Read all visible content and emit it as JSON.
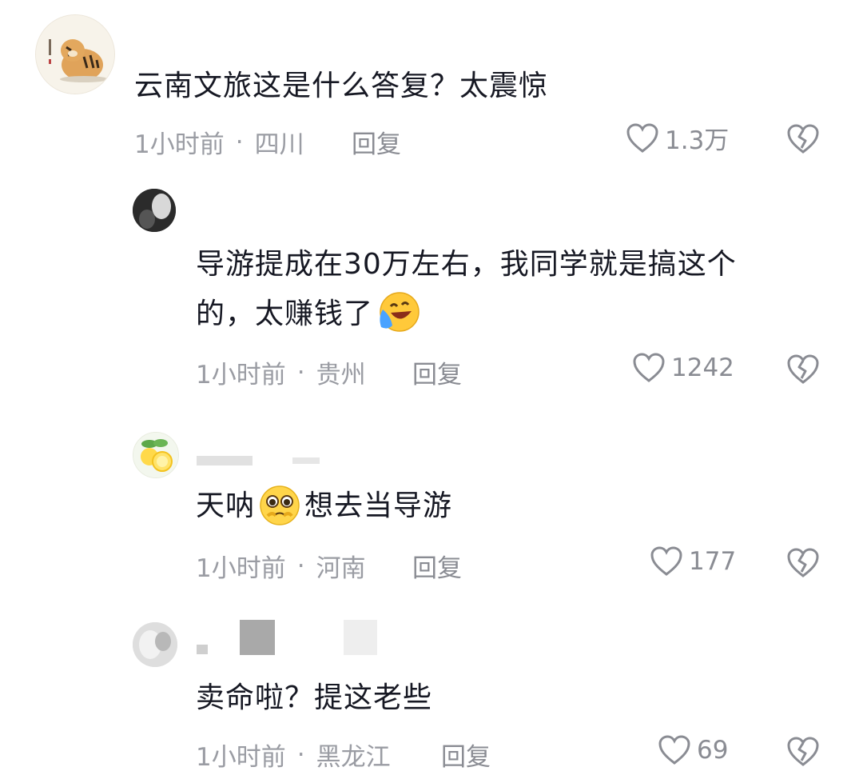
{
  "comments": [
    {
      "text": "云南文旅这是什么答复？太震惊",
      "time": "1小时前",
      "location": "四川",
      "reply_label": "回复",
      "likes": "1.3万"
    },
    {
      "text_line1": "导游提成在30万左右，我同学就是搞这个",
      "text_line2": "的，太赚钱了",
      "emoji": "laughing-tears-emoji",
      "time": "1小时前",
      "location": "贵州",
      "reply_label": "回复",
      "likes": "1242"
    },
    {
      "text_before": "天呐",
      "emoji": "pleading-face-emoji",
      "text_after": "想去当导游",
      "time": "1小时前",
      "location": "河南",
      "reply_label": "回复",
      "likes": "177"
    },
    {
      "text": "卖命啦？提这老些",
      "time": "1小时前",
      "location": "黑龙江",
      "reply_label": "回复",
      "likes": "69"
    }
  ],
  "separator": "·",
  "colors": {
    "text": "#161823",
    "meta": "#9a9ca3",
    "icon": "#8a8c93"
  },
  "icons": {
    "like": "heart-outline-icon",
    "dislike": "broken-heart-icon"
  }
}
